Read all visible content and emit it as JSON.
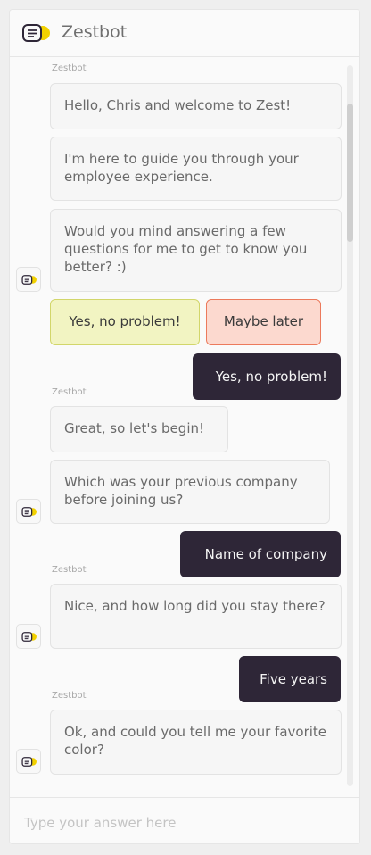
{
  "header": {
    "title": "Zestbot"
  },
  "messages": [
    {
      "sender": "Zestbot",
      "bubbles": [
        "Hello, Chris and welcome to Zest!",
        "I'm here to guide you through your employee experience.",
        "Would you mind answering a few questions for me to get to know you better? :)"
      ]
    }
  ],
  "choices": {
    "yes": "Yes, no problem!",
    "later": "Maybe later"
  },
  "replies": [
    "Yes, no problem!",
    "Name of company",
    "Five years"
  ],
  "bot": {
    "sender": "Zestbot",
    "great": "Great, so let's begin!",
    "previous_company": "Which was your previous company before joining us?",
    "how_long": "Nice, and how long did you stay there?",
    "favorite_color": "Ok, and could you tell me your favorite color?"
  },
  "input": {
    "placeholder": "Type your answer here"
  },
  "colors": {
    "accent": "#f2d100",
    "user_bubble": "#2e2637",
    "yes_bg": "#f2f4c2",
    "later_bg": "#fcd9cf"
  }
}
